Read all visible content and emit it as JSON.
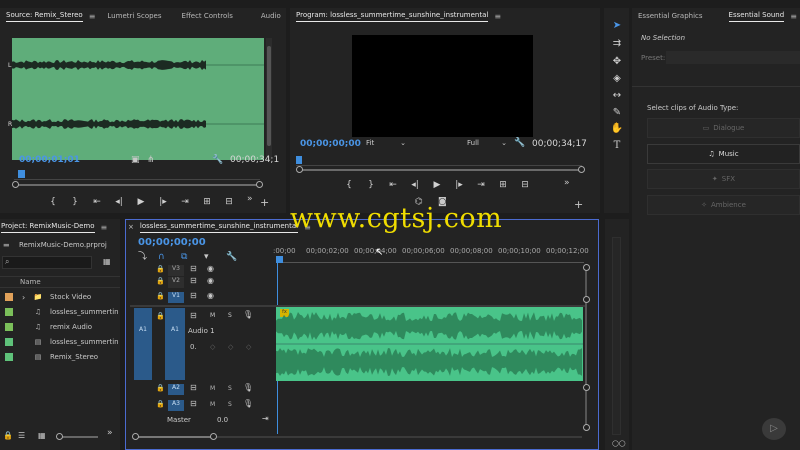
{
  "source_panel": {
    "tabs": [
      "Source: Remix_Stereo",
      "Lumetri Scopes",
      "Effect Controls",
      "Audio"
    ],
    "channel_left": "L",
    "channel_right": "R",
    "timecode_current": "00;00;01;01",
    "timecode_duration": "00;00;34;1"
  },
  "program_panel": {
    "title": "Program: lossless_summertime_sunshine_instrumental",
    "timecode_current": "00;00;00;00",
    "fit_select": "Fit",
    "quality_select": "Full",
    "timecode_duration": "00;00;34;17"
  },
  "essential_panel": {
    "tabs": [
      "Essential Graphics",
      "Essential Sound"
    ],
    "no_selection": "No Selection",
    "preset_label": "Preset:",
    "select_prompt": "Select clips of Audio Type:",
    "types": [
      "Dialogue",
      "Music",
      "SFX",
      "Ambience"
    ],
    "active_type": "Music"
  },
  "project_panel": {
    "title": "Project: RemixMusic-Demo",
    "file": "RemixMusic-Demo.prproj",
    "column_name": "Name",
    "items": [
      {
        "label": "Stock Video",
        "color": "#e0a15a"
      },
      {
        "label": "lossless_summertin",
        "color": "#7bbf5a"
      },
      {
        "label": "remix Audio",
        "color": "#7bbf5a"
      },
      {
        "label": "lossless_summertin",
        "color": "#5fc27a"
      },
      {
        "label": "Remix_Stereo",
        "color": "#5fc27a"
      }
    ]
  },
  "timeline_panel": {
    "sequence_tab": "lossless_summertime_sunshine_instrumental",
    "timecode": "00;00;00;00",
    "ruler": [
      ":00;00",
      "00;00;02;00",
      "00;00;04;00",
      "00;00;06;00",
      "00;00;08;00",
      "00;00;10;00",
      "00;00;12;00"
    ],
    "video_tracks": [
      "V3",
      "V2",
      "V1"
    ],
    "audio_tracks": [
      "A1",
      "A2",
      "A3"
    ],
    "source_patch": "A1",
    "audio1_name": "Audio 1",
    "clip_fx": "fx",
    "master_label": "Master",
    "master_value": "0.0",
    "btn_m": "M",
    "btn_s": "S",
    "volume_value": "0."
  },
  "watermark": "www.cgtsj.com",
  "colors": {
    "accent_blue": "#3f8ede",
    "waveform_bg": "#5fad7a",
    "audio_clip": "#49c489",
    "audio_wave": "#6ddba0"
  }
}
